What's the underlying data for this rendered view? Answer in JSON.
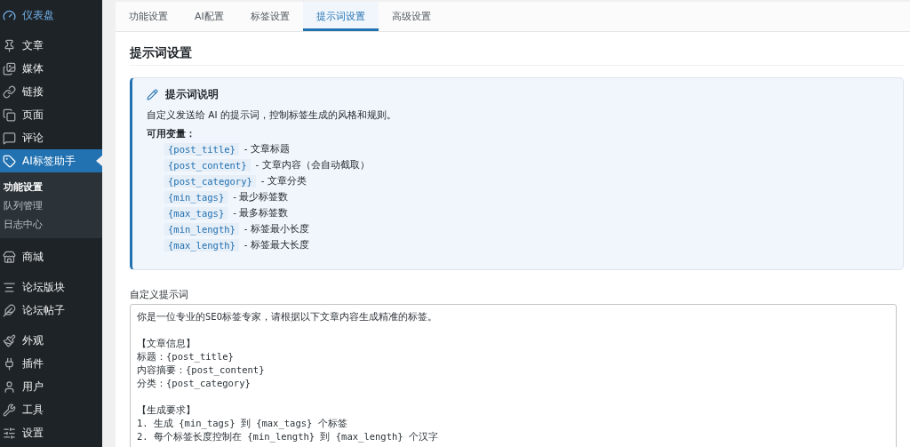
{
  "sidebar": {
    "groups": [
      [
        {
          "label": "仪表盘",
          "hovered": true,
          "selected": false
        }
      ],
      [
        {
          "label": "文章",
          "hovered": false,
          "selected": false
        },
        {
          "label": "媒体",
          "hovered": false,
          "selected": false
        },
        {
          "label": "链接",
          "hovered": false,
          "selected": false
        },
        {
          "label": "页面",
          "hovered": false,
          "selected": false
        },
        {
          "label": "评论",
          "hovered": false,
          "selected": false
        },
        {
          "label": "AI标签助手",
          "hovered": false,
          "selected": true,
          "children": [
            {
              "label": "功能设置",
              "selected": true
            },
            {
              "label": "队列管理",
              "selected": false
            },
            {
              "label": "日志中心",
              "selected": false
            }
          ]
        }
      ],
      [
        {
          "label": "商城",
          "hovered": false,
          "selected": false
        }
      ],
      [
        {
          "label": "论坛版块",
          "hovered": false,
          "selected": false
        },
        {
          "label": "论坛帖子",
          "hovered": false,
          "selected": false
        }
      ],
      [
        {
          "label": "外观",
          "hovered": false,
          "selected": false
        },
        {
          "label": "插件",
          "hovered": false,
          "selected": false
        },
        {
          "label": "用户",
          "hovered": false,
          "selected": false
        },
        {
          "label": "工具",
          "hovered": false,
          "selected": false
        },
        {
          "label": "设置",
          "hovered": false,
          "selected": false
        }
      ]
    ]
  },
  "tabs": [
    {
      "label": "功能设置",
      "selected": false
    },
    {
      "label": "AI配置",
      "selected": false
    },
    {
      "label": "标签设置",
      "selected": false
    },
    {
      "label": "提示词设置",
      "selected": true
    },
    {
      "label": "高级设置",
      "selected": false
    }
  ],
  "section_title": "提示词设置",
  "info": {
    "title": "提示词说明",
    "description": "自定义发送给 AI 的提示词，控制标签生成的风格和规则。",
    "variables_label": "可用变量：",
    "variables": [
      {
        "code": "{post_title}",
        "desc": "- 文章标题"
      },
      {
        "code": "{post_content}",
        "desc": "- 文章内容（会自动截取）"
      },
      {
        "code": "{post_category}",
        "desc": "- 文章分类"
      },
      {
        "code": "{min_tags}",
        "desc": "- 最少标签数"
      },
      {
        "code": "{max_tags}",
        "desc": "- 最多标签数"
      },
      {
        "code": "{min_length}",
        "desc": "- 标签最小长度"
      },
      {
        "code": "{max_length}",
        "desc": "- 标签最大长度"
      }
    ]
  },
  "prompt": {
    "label": "自定义提示词",
    "paragraphs": [
      [
        "你是一位专业的SEO标签专家，请根据以下文章内容生成精准的标签。"
      ],
      [
        "【文章信息】",
        "标题：{post_title}",
        "内容摘要：{post_content}",
        "分类：{post_category}"
      ],
      [
        "【生成要求】",
        "1. 生成 {min_tags} 到 {max_tags} 个标签",
        "2. 每个标签长度控制在 {min_length} 到 {max_length} 个汉字"
      ]
    ]
  }
}
